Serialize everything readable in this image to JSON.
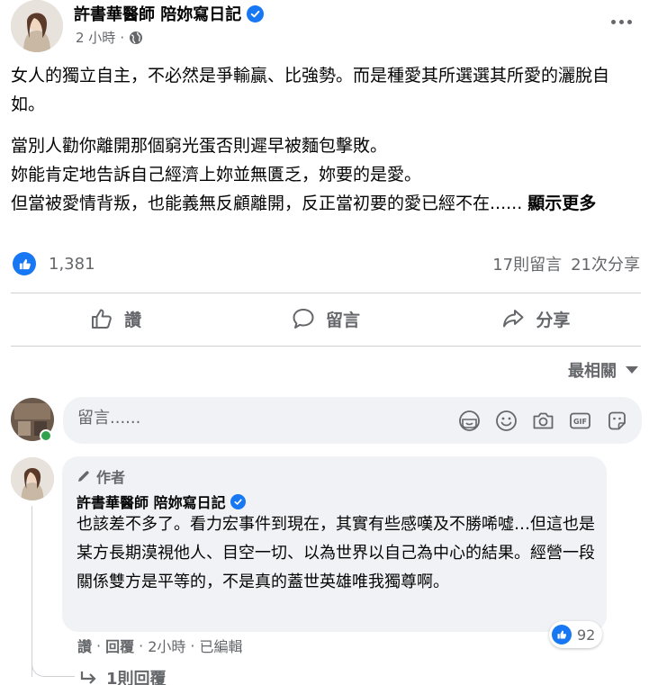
{
  "post": {
    "author": "許書華醫師 陪妳寫日記",
    "time": "2 小時",
    "separator": "·",
    "paragraph1": "女人的獨立自主，不必然是爭輸贏、比強勢。而是種愛其所選選其所愛的灑脫自如。",
    "line2": "當別人勸你離開那個窮光蛋否則遲早被麵包擊敗。",
    "line3": "妳能肯定地告訴自己經濟上妳並無匱乏，妳要的是愛。",
    "line4": "但當被愛情背叛，也能義無反顧離開，反正當初要的愛已經不在......",
    "see_more": "顯示更多"
  },
  "stats": {
    "likes": "1,381",
    "comments": "17則留言",
    "shares": "21次分享"
  },
  "actions": {
    "like": "讚",
    "comment": "留言",
    "share": "分享"
  },
  "sort": {
    "label": "最相關"
  },
  "composer": {
    "placeholder": "留言......"
  },
  "comment": {
    "tag": "作者",
    "author": "許書華醫師 陪妳寫日記",
    "text": "也該差不多了。看力宏事件到現在，其實有些感嘆及不勝唏噓…但這也是某方長期漠視他人、目空一切、以為世界以自己為中心的結果。經營一段關係雙方是平等的，不是真的蓋世英雄唯我獨尊啊。",
    "likes": "92",
    "like_label": "讚",
    "reply_label": "回覆",
    "time": "2小時",
    "edited": "已編輯",
    "separator": "·",
    "replies_link": "1則回覆"
  },
  "colors": {
    "accent": "#1877f2",
    "secondary_text": "#65676b",
    "bubble_bg": "#f0f2f5",
    "online": "#31a24c"
  }
}
